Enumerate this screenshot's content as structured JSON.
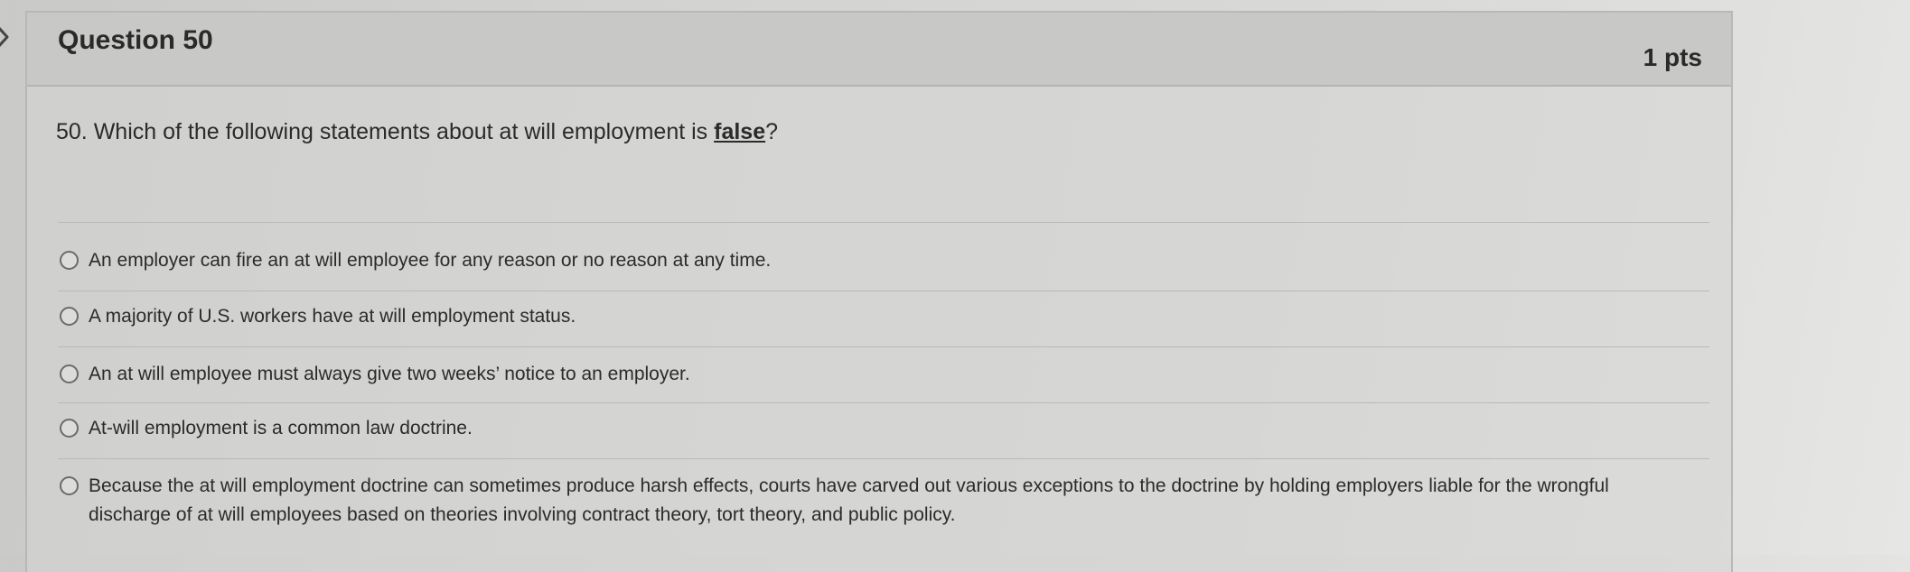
{
  "question": {
    "title": "Question 50",
    "points": "1 pts",
    "prompt_prefix": "50. Which of the following statements about at will employment is ",
    "prompt_emphasis": "false",
    "prompt_suffix": "?"
  },
  "answers": [
    {
      "label": "An employer can fire an at will employee for any reason or no reason at any time.",
      "selected": false
    },
    {
      "label": "A majority of U.S. workers have at will employment status.",
      "selected": false
    },
    {
      "label": "An at will employee must always give two weeks’ notice to an employer.",
      "selected": false
    },
    {
      "label": "At-will employment is a common law doctrine.",
      "selected": false
    },
    {
      "label": "Because the at will employment doctrine can sometimes produce harsh effects, courts have carved out various exceptions to the doctrine by holding employers liable for the wrongful discharge of at will employees based on theories involving contract theory, tort theory, and public policy.",
      "selected": false
    }
  ],
  "colors": {
    "header_bg": "#c8c8c6",
    "page_bg": "#d3d3d1",
    "text": "#2d2d2d"
  },
  "icons": {
    "collapse": "chevron-right-icon"
  }
}
